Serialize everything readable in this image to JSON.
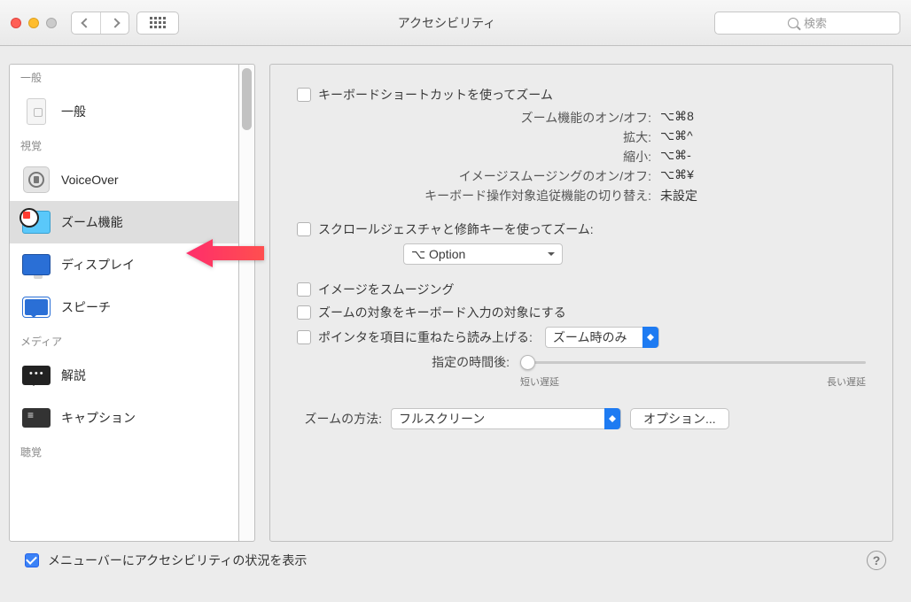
{
  "window": {
    "title": "アクセシビリティ"
  },
  "search": {
    "placeholder": "検索"
  },
  "sidebar": {
    "sections": [
      {
        "header": "一般",
        "items": [
          {
            "label": "一般"
          }
        ]
      },
      {
        "header": "視覚",
        "items": [
          {
            "label": "VoiceOver"
          },
          {
            "label": "ズーム機能",
            "selected": true
          },
          {
            "label": "ディスプレイ"
          },
          {
            "label": "スピーチ"
          }
        ]
      },
      {
        "header": "メディア",
        "items": [
          {
            "label": "解説"
          },
          {
            "label": "キャプション"
          }
        ]
      },
      {
        "header": "聴覚",
        "items": []
      }
    ]
  },
  "panel": {
    "kbShortcutZoom": "キーボードショートカットを使ってズーム",
    "shortcuts": [
      {
        "k": "ズーム機能のオン/オフ:",
        "v": "⌥⌘8"
      },
      {
        "k": "拡大:",
        "v": "⌥⌘^"
      },
      {
        "k": "縮小:",
        "v": "⌥⌘-"
      },
      {
        "k": "イメージスムージングのオン/オフ:",
        "v": "⌥⌘¥"
      },
      {
        "k": "キーボード操作対象追従機能の切り替え:",
        "v": "未設定"
      }
    ],
    "scrollGesture": "スクロールジェスチャと修飾キーを使ってズーム:",
    "modifierSelect": "⌥ Option",
    "smoothImages": "イメージをスムージング",
    "zoomFollowsKb": "ズームの対象をキーボード入力の対象にする",
    "hoverSpeak": "ポインタを項目に重ねたら読み上げる:",
    "hoverScopeSelect": "ズーム時のみ",
    "delayLabel": "指定の時間後:",
    "delayShort": "短い遅延",
    "delayLong": "長い遅延",
    "zoomMethodLabel": "ズームの方法:",
    "zoomMethodSelect": "フルスクリーン",
    "optionsBtn": "オプション..."
  },
  "footer": {
    "showStatus": "メニューバーにアクセシビリティの状況を表示"
  }
}
